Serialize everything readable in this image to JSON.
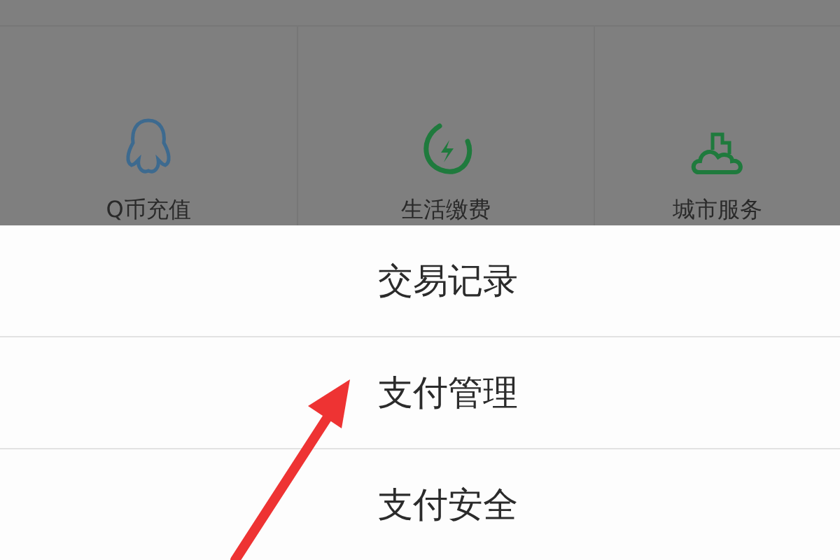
{
  "services": [
    {
      "label": "Q币充值",
      "kind": "penguin"
    },
    {
      "label": "生活缴费",
      "kind": "bolt"
    },
    {
      "label": "城市服务",
      "kind": "city"
    }
  ],
  "action_sheet": {
    "items": [
      {
        "label": "交易记录"
      },
      {
        "label": "支付管理"
      },
      {
        "label": "支付安全"
      }
    ]
  }
}
